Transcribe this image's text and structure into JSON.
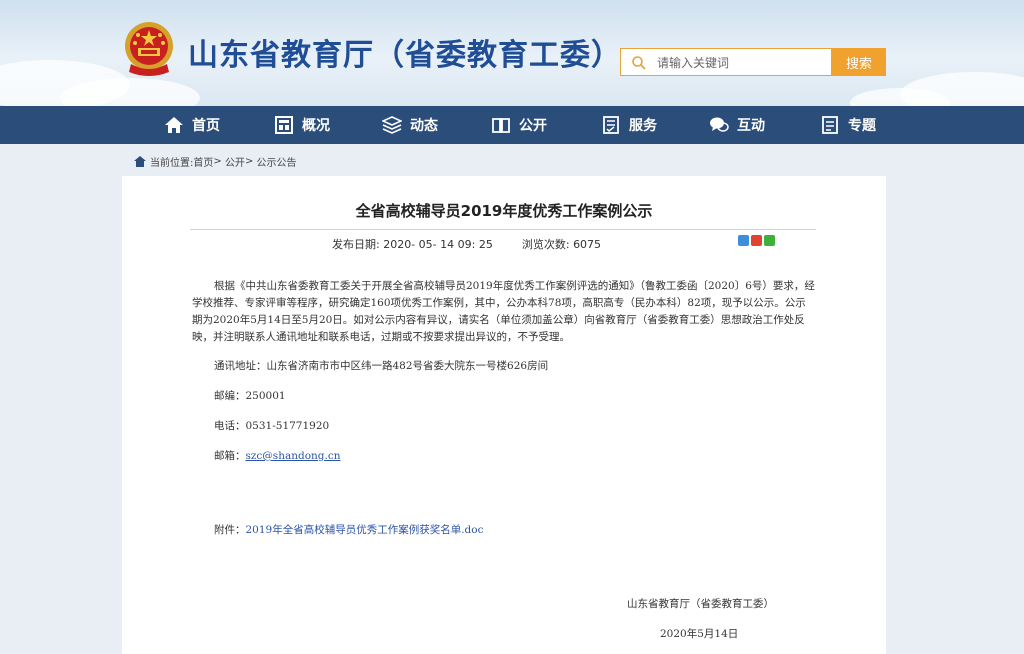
{
  "header": {
    "site_title": "山东省教育厅（省委教育工委）",
    "search_placeholder": "请输入关键词",
    "search_button": "搜索"
  },
  "nav": {
    "items": [
      {
        "label": "首页",
        "icon": "home-icon"
      },
      {
        "label": "概况",
        "icon": "building-icon"
      },
      {
        "label": "动态",
        "icon": "stack-icon"
      },
      {
        "label": "公开",
        "icon": "book-icon"
      },
      {
        "label": "服务",
        "icon": "checklist-icon"
      },
      {
        "label": "互动",
        "icon": "chat-icon"
      },
      {
        "label": "专题",
        "icon": "document-icon"
      }
    ]
  },
  "breadcrumb": {
    "prefix": "当前位置:",
    "items": [
      "首页",
      "公开",
      "公示公告"
    ]
  },
  "article": {
    "title": "全省高校辅导员2019年度优秀工作案例公示",
    "date_label": "发布日期:",
    "date_value": "2020- 05- 14 09: 25",
    "views_label": "浏览次数:",
    "views_value": "6075",
    "paragraph": "根据《中共山东省委教育工委关于开展全省高校辅导员2019年度优秀工作案例评选的通知》（鲁教工委函〔2020〕6号）要求，经学校推荐、专家评审等程序，研究确定160项优秀工作案例，其中，公办本科78项，高职高专（民办本科）82项，现予以公示。公示期为2020年5月14日至5月20日。如对公示内容有异议，请实名（单位须加盖公章）向省教育厅（省委教育工委）思想政治工作处反映，并注明联系人通讯地址和联系电话，过期或不按要求提出异议的，不予受理。",
    "address_label": "通讯地址：",
    "address_value": "山东省济南市市中区纬一路482号省委大院东一号楼626房间",
    "postcode_label": "邮编：",
    "postcode_value": "250001",
    "phone_label": "电话：",
    "phone_value": "0531-51771920",
    "email_label": "邮箱：",
    "email_value": "szc@shandong.cn",
    "attachment_label": "附件：",
    "attachment_value": "2019年全省高校辅导员优秀工作案例获奖名单.doc",
    "sign_org": "山东省教育厅（省委教育工委）",
    "sign_date": "2020年5月14日"
  },
  "colors": {
    "nav_bg": "#2b4d7a",
    "title_blue": "#1f4d96",
    "search_orange": "#f1a12e",
    "link_blue": "#2b55a8"
  }
}
